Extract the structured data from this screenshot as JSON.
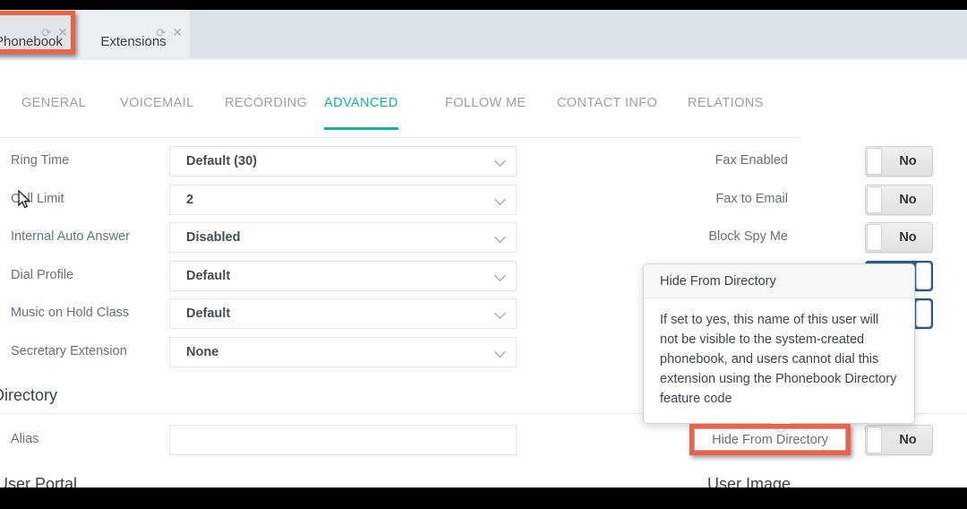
{
  "browser_tabs": [
    {
      "label": "Phonebook",
      "refresh_icon": "refresh-icon",
      "close_icon": "close-icon",
      "active": false,
      "highlighted": true
    },
    {
      "label": "Extensions",
      "refresh_icon": "refresh-icon",
      "close_icon": "close-icon",
      "active": true,
      "highlighted": false
    }
  ],
  "form_tabs": [
    {
      "label": "GENERAL",
      "active": false
    },
    {
      "label": "VOICEMAIL",
      "active": false
    },
    {
      "label": "RECORDING",
      "active": false
    },
    {
      "label": "ADVANCED",
      "active": true
    },
    {
      "label": "FOLLOW ME",
      "active": false
    },
    {
      "label": "CONTACT INFO",
      "active": false
    },
    {
      "label": "RELATIONS",
      "active": false
    }
  ],
  "left_fields": [
    {
      "label": "Ring Time",
      "value": "Default (30)",
      "type": "select"
    },
    {
      "label": "Call Limit",
      "value": "2",
      "type": "select"
    },
    {
      "label": "Internal Auto Answer",
      "value": "Disabled",
      "type": "select"
    },
    {
      "label": "Dial Profile",
      "value": "Default",
      "type": "select"
    },
    {
      "label": "Music on Hold Class",
      "value": "Default",
      "type": "select"
    },
    {
      "label": "Secretary Extension",
      "value": "None",
      "type": "select"
    }
  ],
  "right_fields": [
    {
      "label": "Fax Enabled",
      "value": "No",
      "state": "off"
    },
    {
      "label": "Fax to Email",
      "value": "No",
      "state": "off"
    },
    {
      "label": "Block Spy Me",
      "value": "No",
      "state": "off"
    },
    {
      "label": "",
      "value": "",
      "state": "on"
    },
    {
      "label": "",
      "value": "",
      "state": "on"
    }
  ],
  "directory_section": {
    "title": "Directory",
    "alias_label": "Alias",
    "alias_value": "",
    "alias_placeholder": "",
    "hide_from_directory_label": "Hide From Directory",
    "hide_from_directory_value": "No",
    "hide_from_directory_state": "off"
  },
  "bottom_partial": {
    "left": "User Portal",
    "right": "User Image"
  },
  "tooltip": {
    "title": "Hide From Directory",
    "body": "If set to yes, this name of this user will not be visible to the system-created phonebook, and users cannot dial this extension using the Phonebook Directory feature code"
  },
  "colors": {
    "accent_teal": "#0fb3a7",
    "highlight_red": "#ef6049",
    "toggle_on_blue": "#2a5ea0",
    "label_gray": "#67707a",
    "tabstrip_bg": "#dde1e8"
  }
}
